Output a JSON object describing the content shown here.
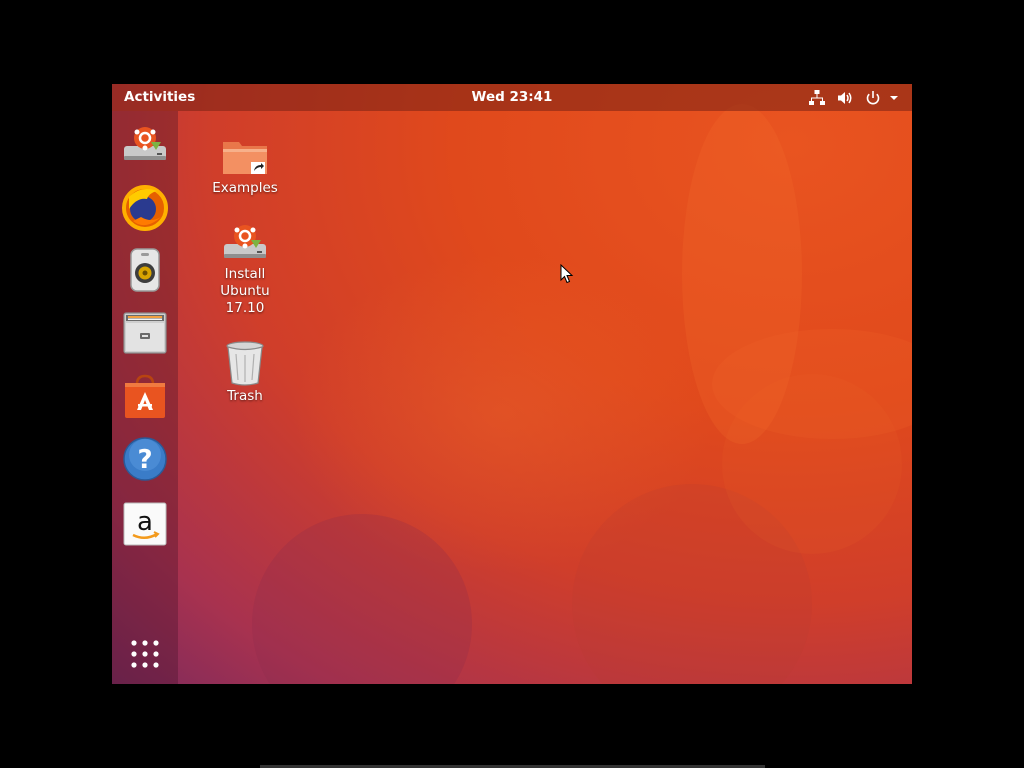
{
  "topbar": {
    "activities_label": "Activities",
    "clock": "Wed 23:41",
    "tray_icons": [
      "network-icon",
      "volume-icon",
      "power-icon",
      "chevron-down-icon"
    ]
  },
  "dock": {
    "items": [
      {
        "name": "install-ubuntu",
        "icon": "installer-icon"
      },
      {
        "name": "firefox",
        "icon": "firefox-icon"
      },
      {
        "name": "rhythmbox",
        "icon": "speaker-icon"
      },
      {
        "name": "files",
        "icon": "file-cabinet-icon"
      },
      {
        "name": "ubuntu-software",
        "icon": "software-bag-icon"
      },
      {
        "name": "help",
        "icon": "question-icon"
      },
      {
        "name": "amazon",
        "icon": "amazon-icon"
      }
    ],
    "show_apps_icon": "app-grid-icon"
  },
  "desktop": {
    "icons": [
      {
        "label": "Examples",
        "icon": "folder-link-icon"
      },
      {
        "label": "Install\nUbuntu\n17.10",
        "icon": "installer-icon"
      },
      {
        "label": "Trash",
        "icon": "trash-icon"
      }
    ]
  },
  "colors": {
    "accent": "#e95420",
    "aubergine": "#7c2a5c"
  }
}
